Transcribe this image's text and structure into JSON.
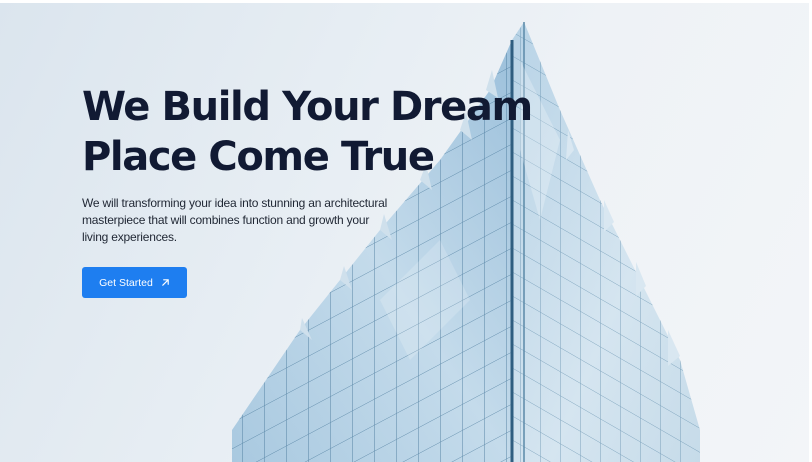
{
  "hero": {
    "title_line1": "We Build Your Dream",
    "title_line2": "Place Come True",
    "subtitle_line1": "We will transforming your idea into stunning an architectural",
    "subtitle_line2": "masterpiece that will combines function and  growth your",
    "subtitle_line3": "living experiences.",
    "cta_label": "Get Started",
    "cta_icon": "arrow-up-right-icon"
  },
  "colors": {
    "background": "#e6edf3",
    "title": "#111a33",
    "body_text": "#1f2633",
    "accent": "#1e7ef0",
    "glass": "#8fb9d8"
  }
}
